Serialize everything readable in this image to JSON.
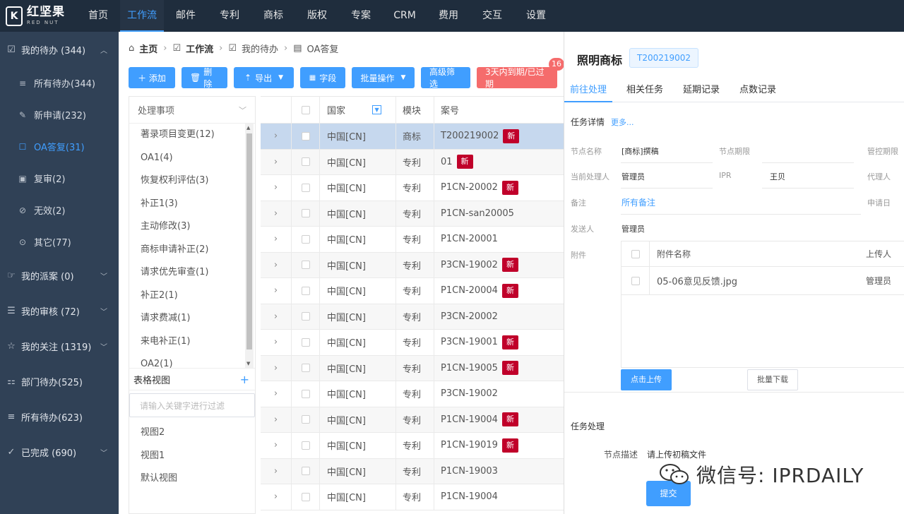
{
  "app": {
    "logo_cn": "红坚果",
    "logo_en": "RED NUT",
    "logo_mark": "K"
  },
  "nav": [
    "首页",
    "工作流",
    "邮件",
    "专利",
    "商标",
    "版权",
    "专案",
    "CRM",
    "费用",
    "交互",
    "设置"
  ],
  "sidebar": {
    "todo": "我的待办 (344)",
    "subs": [
      {
        "icon": "≡",
        "label": "所有待办(344)"
      },
      {
        "icon": "✎",
        "label": "新申请(232)"
      },
      {
        "icon": "☐",
        "label": "OA答复(31)"
      },
      {
        "icon": "▣",
        "label": "复审(2)"
      },
      {
        "icon": "⊘",
        "label": "无效(2)"
      },
      {
        "icon": "⊙",
        "label": "其它(77)"
      }
    ],
    "groups": [
      {
        "icon": "☞",
        "label": "我的派案 (0)",
        "chev": true
      },
      {
        "icon": "☰",
        "label": "我的审核 (72)",
        "chev": true
      },
      {
        "icon": "☆",
        "label": "我的关注 (1319)",
        "chev": true
      },
      {
        "icon": "⚏",
        "label": "部门待办(525)",
        "chev": false
      },
      {
        "icon": "≡",
        "label": "所有待办(623)",
        "chev": false
      },
      {
        "icon": "✓",
        "label": "已完成 (690)",
        "chev": true
      }
    ]
  },
  "breadcrumb": {
    "home": "主页",
    "workflow": "工作流",
    "mytodo": "我的待办",
    "oa": "OA答复"
  },
  "toolbar": {
    "add": "＋ 添加",
    "delete": "删除",
    "export": "导出",
    "fields": "字段",
    "batch": "批量操作",
    "advanced": "高级筛选",
    "due": "3天内到期/已过期",
    "badge": "16"
  },
  "filter": {
    "title": "处理事项",
    "items": [
      "著录项目变更(12)",
      "OA1(4)",
      "恢复权利评估(3)",
      "补正1(3)",
      "主动修改(3)",
      "商标申请补正(2)",
      "请求优先审查(1)",
      "补正2(1)",
      "请求费减(1)",
      "来电补正(1)",
      "OA2(1)"
    ]
  },
  "views": {
    "title": "表格视图",
    "search_placeholder": "请输入关键字进行过滤",
    "items": [
      "视图2",
      "视图1",
      "默认视图"
    ]
  },
  "table": {
    "headers": {
      "country": "国家",
      "module": "模块",
      "case": "案号"
    },
    "new_label": "新",
    "rows": [
      {
        "country": "中国[CN]",
        "module": "商标",
        "case": "T200219002",
        "isnew": true
      },
      {
        "country": "中国[CN]",
        "module": "专利",
        "case": "01",
        "isnew": true
      },
      {
        "country": "中国[CN]",
        "module": "专利",
        "case": "P1CN-20002",
        "isnew": true
      },
      {
        "country": "中国[CN]",
        "module": "专利",
        "case": "P1CN-san20005",
        "isnew": false
      },
      {
        "country": "中国[CN]",
        "module": "专利",
        "case": "P1CN-20001",
        "isnew": false
      },
      {
        "country": "中国[CN]",
        "module": "专利",
        "case": "P3CN-19002",
        "isnew": true
      },
      {
        "country": "中国[CN]",
        "module": "专利",
        "case": "P1CN-20004",
        "isnew": true
      },
      {
        "country": "中国[CN]",
        "module": "专利",
        "case": "P3CN-20002",
        "isnew": false
      },
      {
        "country": "中国[CN]",
        "module": "专利",
        "case": "P3CN-19001",
        "isnew": true
      },
      {
        "country": "中国[CN]",
        "module": "专利",
        "case": "P1CN-19005",
        "isnew": true
      },
      {
        "country": "中国[CN]",
        "module": "专利",
        "case": "P3CN-19002",
        "isnew": false
      },
      {
        "country": "中国[CN]",
        "module": "专利",
        "case": "P1CN-19004",
        "isnew": true
      },
      {
        "country": "中国[CN]",
        "module": "专利",
        "case": "P1CN-19019",
        "isnew": true
      },
      {
        "country": "中国[CN]",
        "module": "专利",
        "case": "P1CN-19003",
        "isnew": false
      },
      {
        "country": "中国[CN]",
        "module": "专利",
        "case": "P1CN-19004",
        "isnew": false
      }
    ]
  },
  "detail": {
    "title": "照明商标",
    "tag": "T200219002",
    "tabs": [
      "前往处理",
      "相关任务",
      "延期记录",
      "点数记录"
    ],
    "task_detail": "任务详情",
    "more": "更多...",
    "node_name_l": "节点名称",
    "node_name_v": "[商标]撰稿",
    "node_deadline_l": "节点期限",
    "ctrl_deadline_l": "管控期限",
    "handler_l": "当前处理人",
    "handler_v": "管理员",
    "ipr_l": "IPR",
    "ipr_v": "王贝",
    "agent_l": "代理人",
    "note_l": "备注",
    "note_v": "所有备注",
    "apply_date_l": "申请日",
    "sender_l": "发送人",
    "sender_v": "管理员",
    "attach_l": "附件",
    "attach_name_h": "附件名称",
    "uploader_h": "上传人",
    "attach_file": "05-06意见反馈.jpg",
    "attach_uploader": "管理员",
    "upload_btn": "点击上传",
    "batch_dl": "批量下载",
    "task_process": "任务处理",
    "node_desc_l": "节点描述",
    "node_desc_v": "请上传初稿文件",
    "submit": "提交"
  },
  "watermark": "微信号: IPRDAILY"
}
